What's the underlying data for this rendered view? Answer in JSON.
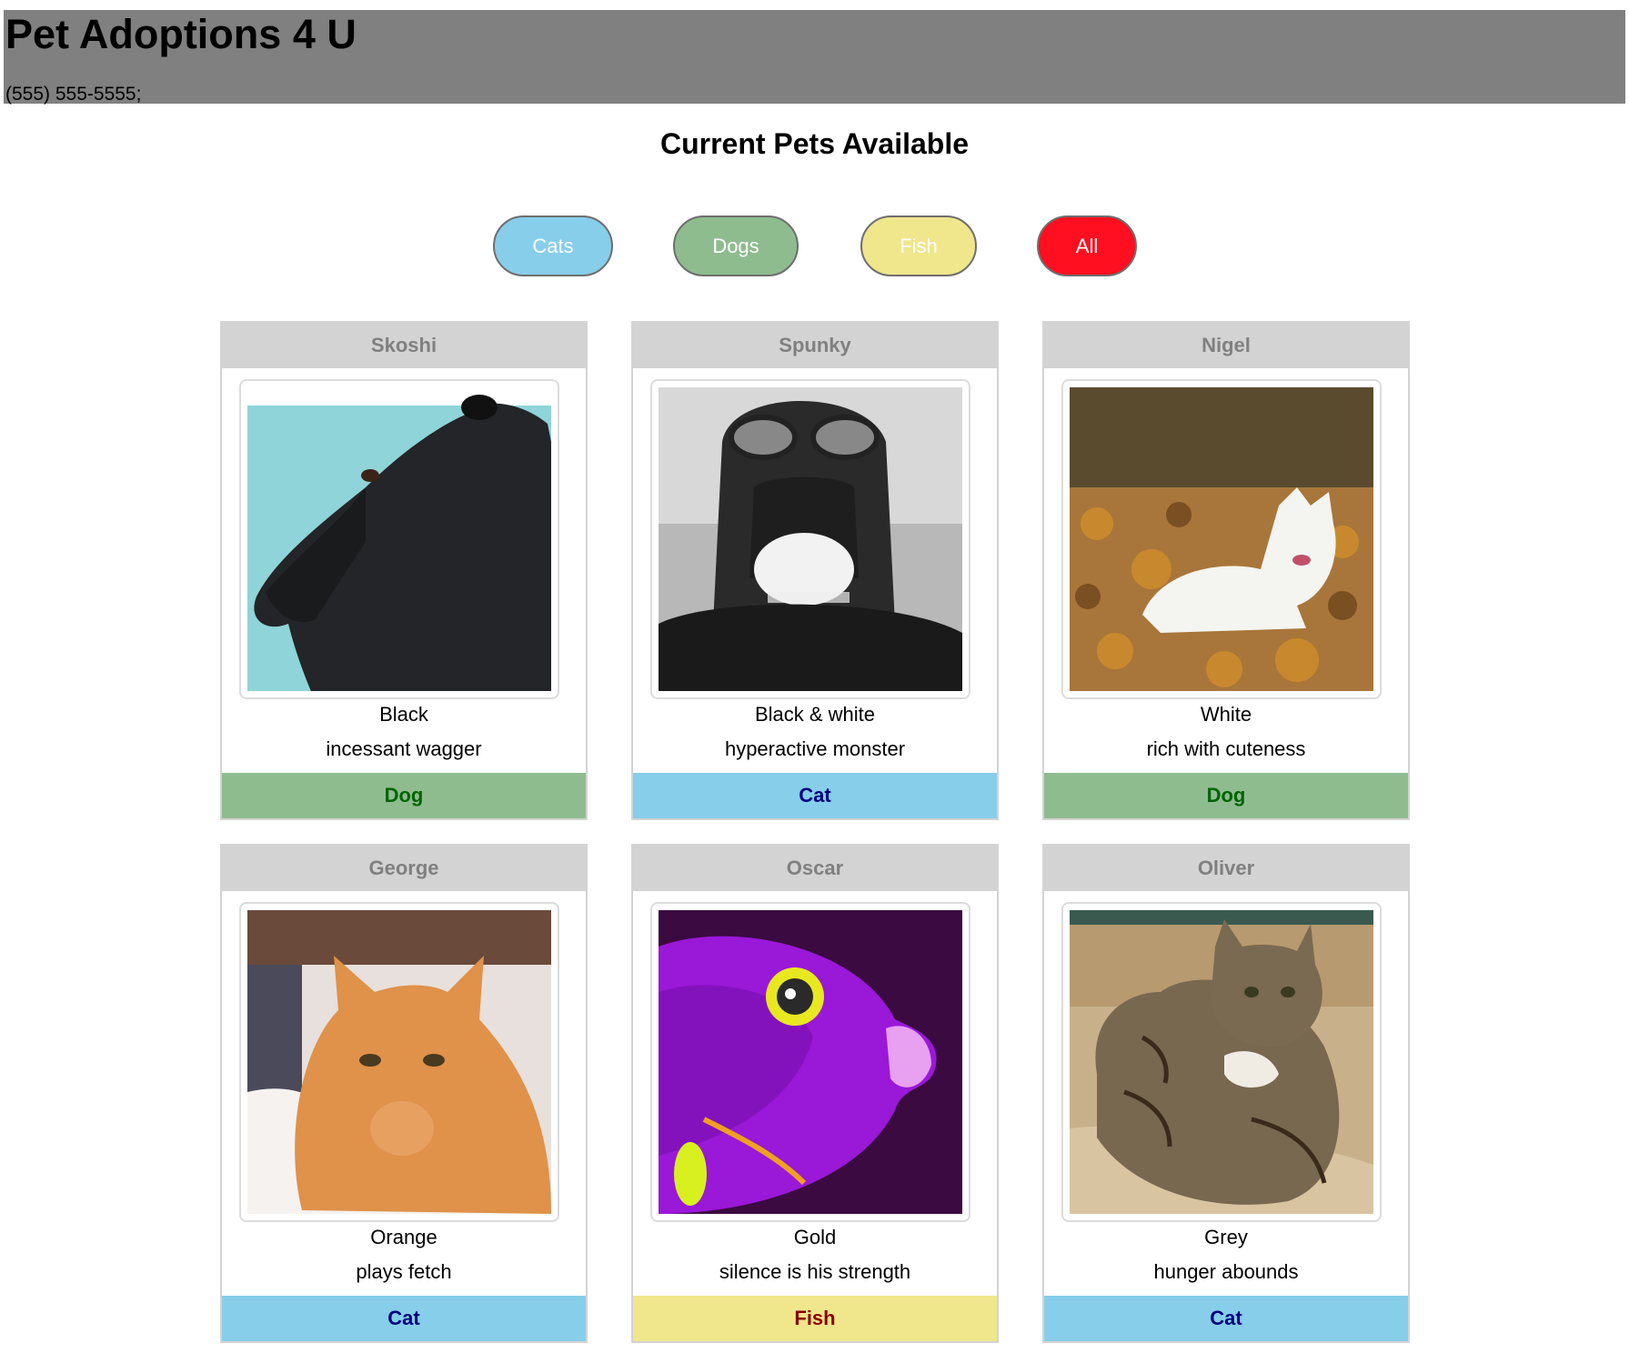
{
  "site": {
    "title": "Pet Adoptions 4 U",
    "phone": "(555) 555-5555;"
  },
  "page": {
    "heading": "Current Pets Available"
  },
  "filters": [
    {
      "label": "Cats",
      "color": "#87ceeb"
    },
    {
      "label": "Dogs",
      "color": "#8fbc8f"
    },
    {
      "label": "Fish",
      "color": "#f0e68c"
    },
    {
      "label": "All",
      "color": "#ff0f1f"
    }
  ],
  "pets": [
    {
      "name": "Skoshi",
      "color": "Black",
      "description": "incessant wagger",
      "type": "Dog",
      "photo_icon": "black-dog-photo"
    },
    {
      "name": "Spunky",
      "color": "Black & white",
      "description": "hyperactive monster",
      "type": "Cat",
      "photo_icon": "cat-with-goggles-photo"
    },
    {
      "name": "Nigel",
      "color": "White",
      "description": "rich with cuteness",
      "type": "Dog",
      "photo_icon": "white-dog-in-leaves-photo"
    },
    {
      "name": "George",
      "color": "Orange",
      "description": "plays fetch",
      "type": "Cat",
      "photo_icon": "orange-cat-photo"
    },
    {
      "name": "Oscar",
      "color": "Gold",
      "description": "silence is his strength",
      "type": "Fish",
      "photo_icon": "purple-fish-photo"
    },
    {
      "name": "Oliver",
      "color": "Grey",
      "description": "hunger abounds",
      "type": "Cat",
      "photo_icon": "tabby-cat-on-couch-photo"
    }
  ],
  "type_colors": {
    "Dog": {
      "bg": "#8fbc8f",
      "text": "#006400"
    },
    "Cat": {
      "bg": "#87ceeb",
      "text": "#000080"
    },
    "Fish": {
      "bg": "#f0e68c",
      "text": "#8b0000"
    }
  }
}
